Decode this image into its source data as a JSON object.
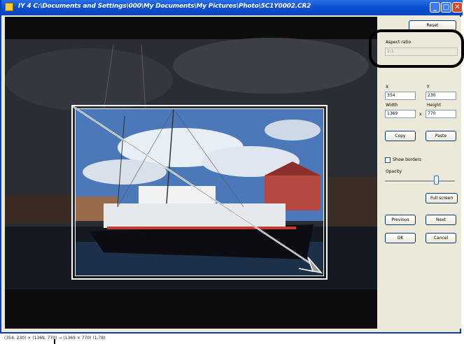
{
  "window": {
    "title": "IY 4 C:\\Documents and Settings\\000\\My Documents\\My Pictures\\Photo\\5C1Y0002.CR2",
    "buttons": {
      "minimize": "_",
      "maximize": "□",
      "close": "✕"
    }
  },
  "panel": {
    "reset_button": "Reset",
    "aspect_ratio_label": "Aspect ratio",
    "aspect_ratio_value": "1:1",
    "x_label": "X",
    "y_label": "Y",
    "x_value": "354",
    "y_value": "230",
    "width_label": "Width",
    "height_label": "Height",
    "width_value": "1369",
    "height_value": "770",
    "times_sign": "x",
    "copy_button": "Copy",
    "paste_button": "Paste",
    "show_borders_label": "Show borders",
    "opacity_label": "Opacity",
    "full_screen_button": "Full screen",
    "previous_button": "Previous",
    "next_button": "Next",
    "ok_button": "OK",
    "cancel_button": "Cancel"
  },
  "status_bar": {
    "text": "(354, 230) × (1369, 770)  →  (1369 × 770) (1.78)"
  }
}
